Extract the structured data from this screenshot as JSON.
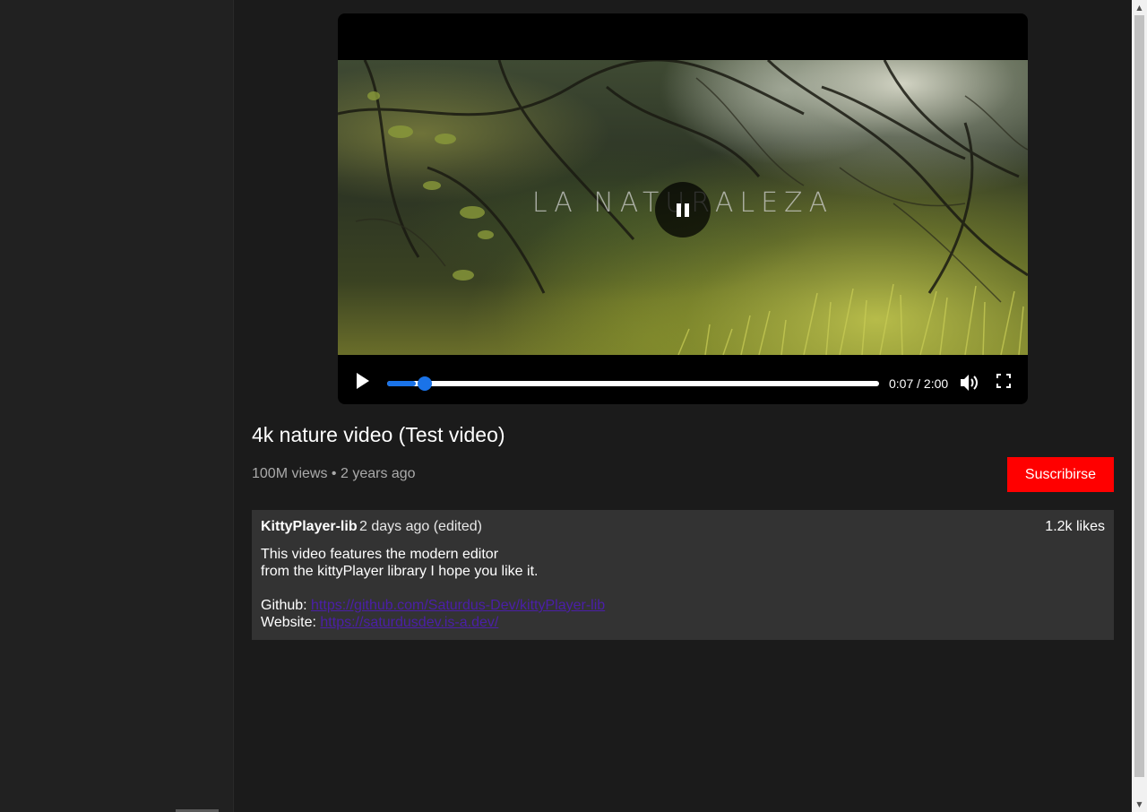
{
  "video": {
    "overlay_text": "LA NATURALEZA",
    "current_time": "0:07",
    "duration": "2:00",
    "time_display": "0:07 / 2:00",
    "progress_fraction": 0.0583,
    "play_icon": "play-icon",
    "center_icon": "pause-icon",
    "volume_icon": "volume-icon",
    "fullscreen_icon": "fullscreen-icon"
  },
  "info": {
    "title": "4k nature video (Test video)",
    "meta": "100M views • 2 years ago",
    "subscribe_label": "Suscribirse"
  },
  "description": {
    "author": "KittyPlayer-lib",
    "when": "2 days ago (edited)",
    "likes": "1.2k likes",
    "line1": "This video features the modern editor",
    "line2": "from the kittyPlayer library I hope you like it.",
    "github_label": "Github: ",
    "github_url": "https://github.com/Saturdus-Dev/kittyPlayer-lib",
    "website_label": "Website: ",
    "website_url": "https://saturdusdev.is-a.dev/"
  },
  "colors": {
    "background": "#1b1b1b",
    "sidebar": "#212121",
    "accent": "#1a73e8",
    "subscribe": "#ff0000",
    "link": "#4b1fa8"
  }
}
